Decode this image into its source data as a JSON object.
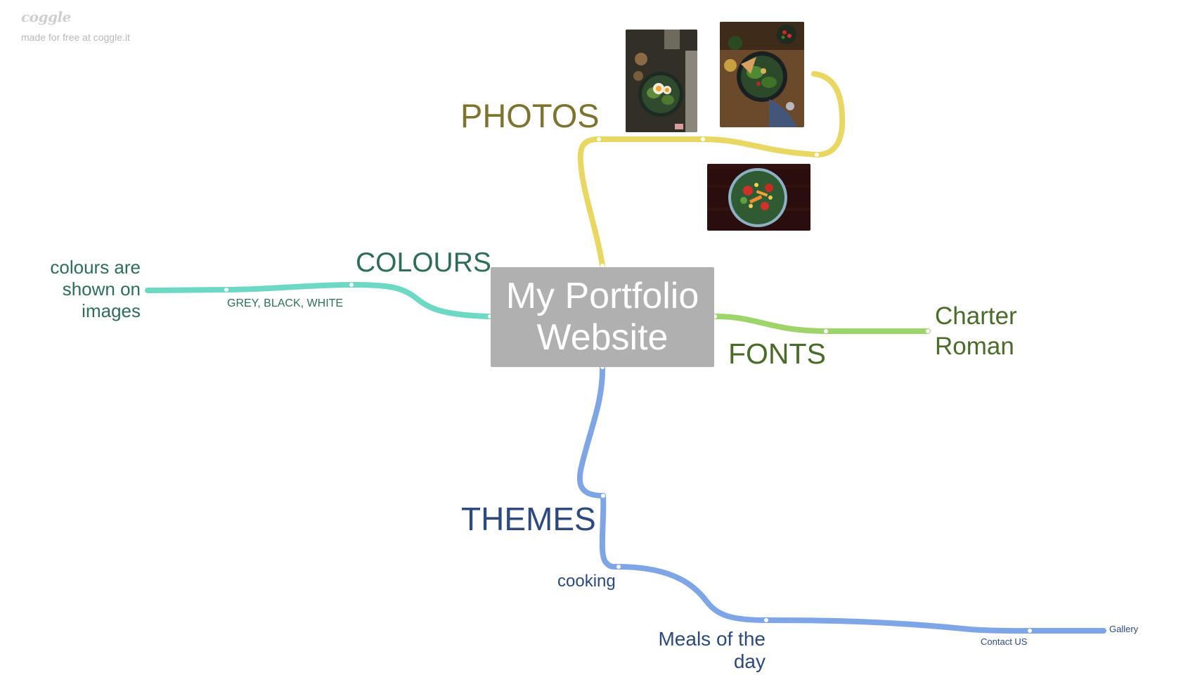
{
  "watermark": {
    "logo": "coggle",
    "text": "made for free at coggle.it"
  },
  "root": {
    "title": "My Portfolio Website"
  },
  "branches": {
    "photos": {
      "label": "PHOTOS",
      "color": "#e9d763",
      "text_color": "#7d7430",
      "images": [
        "food-photo-egg-bowl",
        "food-photo-salad-table",
        "food-photo-salad-dark"
      ]
    },
    "colours": {
      "label": "COLOURS",
      "color": "#6dd8c3",
      "text_color": "#2e6d5a",
      "children": [
        "GREY, BLACK, WHITE",
        "colours are\nshown on\nimages"
      ]
    },
    "fonts": {
      "label": "FONTS",
      "color": "#9ed56a",
      "text_color": "#4a6b2a",
      "children": [
        "Charter\nRoman"
      ]
    },
    "themes": {
      "label": "THEMES",
      "color": "#7ea6e6",
      "text_color": "#2c4a7e",
      "children": [
        "cooking",
        "Meals of the\nday",
        "Contact US",
        "Gallery"
      ]
    }
  }
}
